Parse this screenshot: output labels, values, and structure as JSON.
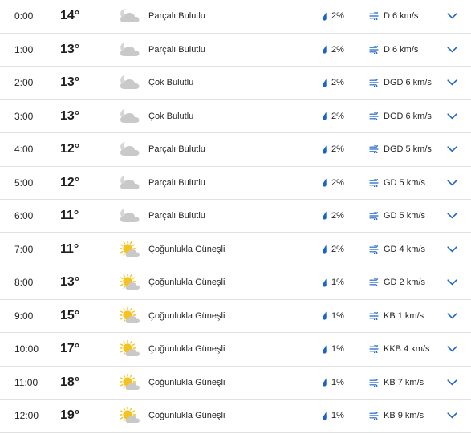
{
  "colors": {
    "accent": "#1a64c9",
    "divider": "#e1e1e1",
    "cloud": "#c9c9c9",
    "sun": "#f5c320"
  },
  "hours": [
    {
      "time": "0:00",
      "temp": "14°",
      "icon": "partly-cloudy-night-icon",
      "condition": "Parçalı Bulutlu",
      "precip": "2%",
      "wind": "D 6 km/s"
    },
    {
      "time": "1:00",
      "temp": "13°",
      "icon": "partly-cloudy-night-icon",
      "condition": "Parçalı Bulutlu",
      "precip": "2%",
      "wind": "D 6 km/s"
    },
    {
      "time": "2:00",
      "temp": "13°",
      "icon": "mostly-cloudy-night-icon",
      "condition": "Çok Bulutlu",
      "precip": "2%",
      "wind": "DGD 6 km/s"
    },
    {
      "time": "3:00",
      "temp": "13°",
      "icon": "mostly-cloudy-night-icon",
      "condition": "Çok Bulutlu",
      "precip": "2%",
      "wind": "DGD 6 km/s"
    },
    {
      "time": "4:00",
      "temp": "12°",
      "icon": "partly-cloudy-night-icon",
      "condition": "Parçalı Bulutlu",
      "precip": "2%",
      "wind": "DGD 5 km/s"
    },
    {
      "time": "5:00",
      "temp": "12°",
      "icon": "partly-cloudy-night-icon",
      "condition": "Parçalı Bulutlu",
      "precip": "2%",
      "wind": "GD 5 km/s"
    },
    {
      "time": "6:00",
      "temp": "11°",
      "icon": "partly-cloudy-night-icon",
      "condition": "Parçalı Bulutlu",
      "precip": "2%",
      "wind": "GD 5 km/s"
    },
    {
      "time": "7:00",
      "temp": "11°",
      "icon": "mostly-sunny-icon",
      "condition": "Çoğunlukla Güneşli",
      "precip": "2%",
      "wind": "GD 4 km/s"
    },
    {
      "time": "8:00",
      "temp": "13°",
      "icon": "mostly-sunny-icon",
      "condition": "Çoğunlukla Güneşli",
      "precip": "1%",
      "wind": "GD 2 km/s"
    },
    {
      "time": "9:00",
      "temp": "15°",
      "icon": "mostly-sunny-icon",
      "condition": "Çoğunlukla Güneşli",
      "precip": "1%",
      "wind": "KB 1 km/s"
    },
    {
      "time": "10:00",
      "temp": "17°",
      "icon": "mostly-sunny-icon",
      "condition": "Çoğunlukla Güneşli",
      "precip": "1%",
      "wind": "KKB 4 km/s"
    },
    {
      "time": "11:00",
      "temp": "18°",
      "icon": "mostly-sunny-icon",
      "condition": "Çoğunlukla Güneşli",
      "precip": "1%",
      "wind": "KB 7 km/s"
    },
    {
      "time": "12:00",
      "temp": "19°",
      "icon": "mostly-sunny-icon",
      "condition": "Çoğunlukla Güneşli",
      "precip": "1%",
      "wind": "KB 9 km/s"
    }
  ]
}
